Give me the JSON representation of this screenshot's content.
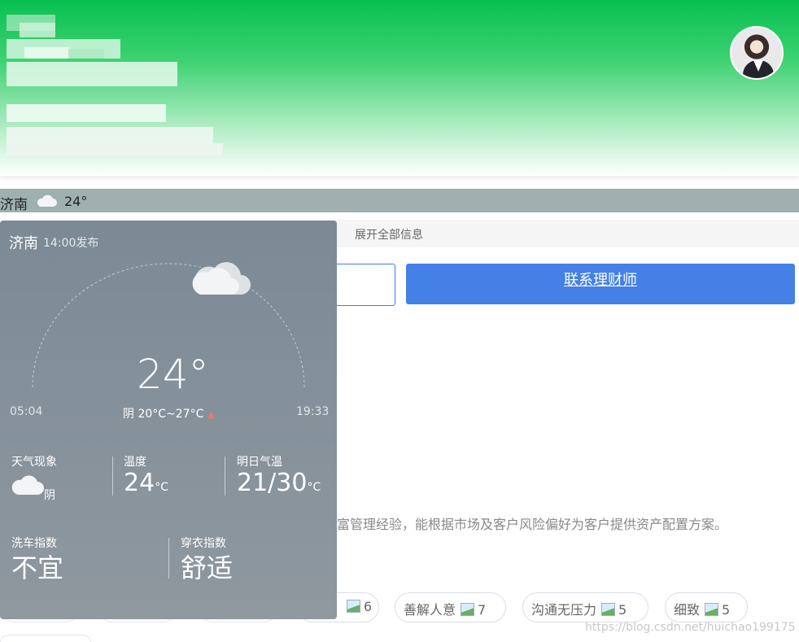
{
  "weather_bar": {
    "city": "济南",
    "temp": "24°"
  },
  "expand": {
    "label": "展开全部信息"
  },
  "contact_button": {
    "label": "联系理财师"
  },
  "description": "财富管理经验，能根据市场及客户风险偏好为客户提供资产配置方案。",
  "tags": [
    {
      "label": "",
      "count": "6"
    },
    {
      "label": "善解人意",
      "count": "7"
    },
    {
      "label": "沟通无压力",
      "count": "5"
    },
    {
      "label": "细致",
      "count": "5"
    }
  ],
  "popup": {
    "city": "济南",
    "publish_time": "14:00发布",
    "current_temp": "24°",
    "sunrise": "05:04",
    "sunset": "19:33",
    "range": "阴 20°C~27°C",
    "phenomenon_label": "天气现象",
    "phenomenon_value": "阴",
    "temp_label": "温度",
    "temp_value": "24",
    "temp_unit": "°C",
    "tomorrow_label": "明日气温",
    "tomorrow_value": "21/30",
    "tomorrow_unit": "°C",
    "carwash_label": "洗车指数",
    "carwash_value": "不宜",
    "dress_label": "穿衣指数",
    "dress_value": "舒适"
  },
  "watermark": "https://blog.csdn.net/huichao199175",
  "colors": {
    "brand_green": "#08c050",
    "button_blue": "#4580e6",
    "popup_bg": "#7c8a96"
  }
}
